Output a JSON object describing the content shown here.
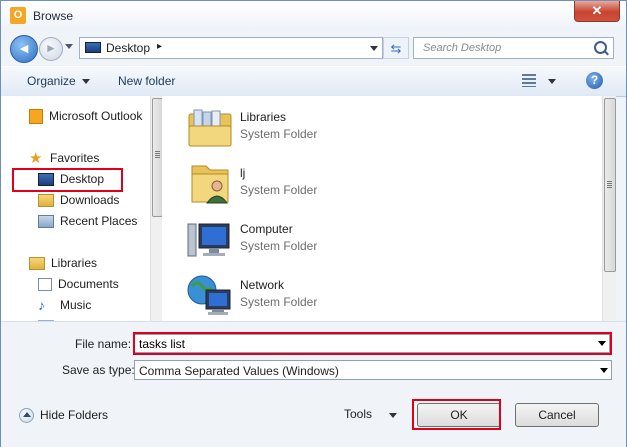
{
  "window": {
    "title": "Browse",
    "app_icon_letter": "O",
    "close_glyph": "✕"
  },
  "nav": {
    "back_glyph": "◄",
    "forward_glyph": "►",
    "address": "Desktop",
    "address_separator": "▸",
    "refresh_glyph": "⇆",
    "search_placeholder": "Search Desktop"
  },
  "toolbar": {
    "organize": "Organize",
    "new_folder": "New folder",
    "help_glyph": "?"
  },
  "sidebar": {
    "items": [
      {
        "label": "Microsoft Outlook",
        "icon": "outlook-icon"
      },
      {
        "label": "Favorites",
        "icon": "star-icon"
      },
      {
        "label": "Desktop",
        "icon": "desktop-icon",
        "selected": true
      },
      {
        "label": "Downloads",
        "icon": "downloads-icon"
      },
      {
        "label": "Recent Places",
        "icon": "recent-places-icon"
      },
      {
        "label": "Libraries",
        "icon": "libraries-icon"
      },
      {
        "label": "Documents",
        "icon": "documents-icon"
      },
      {
        "label": "Music",
        "icon": "music-icon"
      }
    ]
  },
  "files": [
    {
      "name": "Libraries",
      "type": "System Folder",
      "icon": "libraries-folder-icon"
    },
    {
      "name": "lj",
      "type": "System Folder",
      "icon": "user-folder-icon"
    },
    {
      "name": "Computer",
      "type": "System Folder",
      "icon": "computer-icon"
    },
    {
      "name": "Network",
      "type": "System Folder",
      "icon": "network-icon"
    }
  ],
  "form": {
    "file_name_label": "File name:",
    "file_name_value": "tasks list",
    "save_as_label": "Save as type:",
    "save_as_value": "Comma Separated Values (Windows)"
  },
  "footer": {
    "hide_folders": "Hide Folders",
    "tools": "Tools",
    "ok": "OK",
    "cancel": "Cancel"
  },
  "colors": {
    "highlight": "#e0001b",
    "accent": "#2d6fc2"
  }
}
